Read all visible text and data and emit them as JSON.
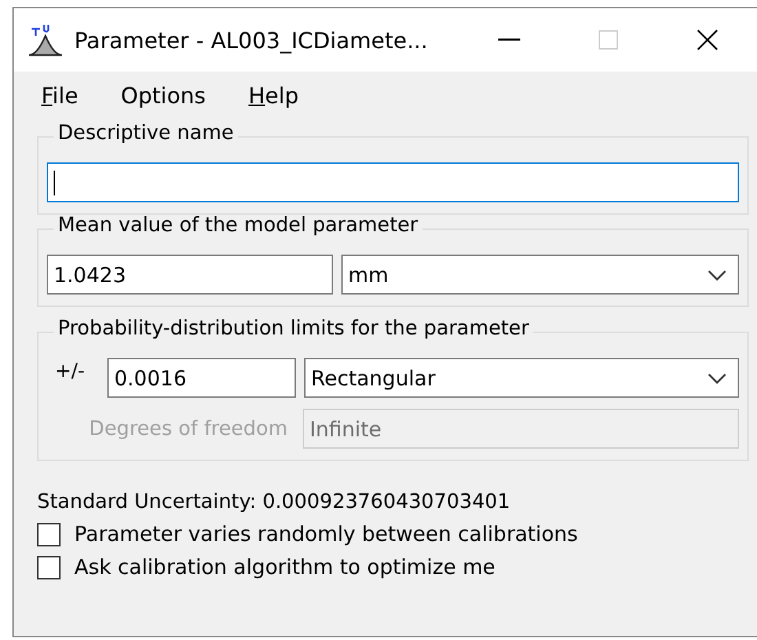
{
  "window": {
    "title": "Parameter - AL003_ICDiamete..."
  },
  "menu": [
    {
      "label": "File",
      "underline_first": true
    },
    {
      "label": "Options",
      "underline_first": false
    },
    {
      "label": "Help",
      "underline_first": true
    }
  ],
  "descriptive_name": {
    "legend": "Descriptive name",
    "focused": true
  },
  "mean_value": {
    "legend": "Mean value of the model parameter",
    "value": "1.0423",
    "unit": "mm"
  },
  "distribution": {
    "legend": "Probability-distribution limits for the parameter",
    "plus_minus": "+/-",
    "limit": "0.0016",
    "type": "Rectangular",
    "dof_label": "Degrees of freedom",
    "dof_value": "Infinite",
    "dof_disabled": true
  },
  "standard_uncertainty": "Standard Uncertainty: 0.000923760430703401",
  "options": [
    {
      "label": "Parameter varies randomly between calibrations",
      "checked": false
    },
    {
      "label": "Ask calibration algorithm to optimize me",
      "checked": false
    }
  ]
}
